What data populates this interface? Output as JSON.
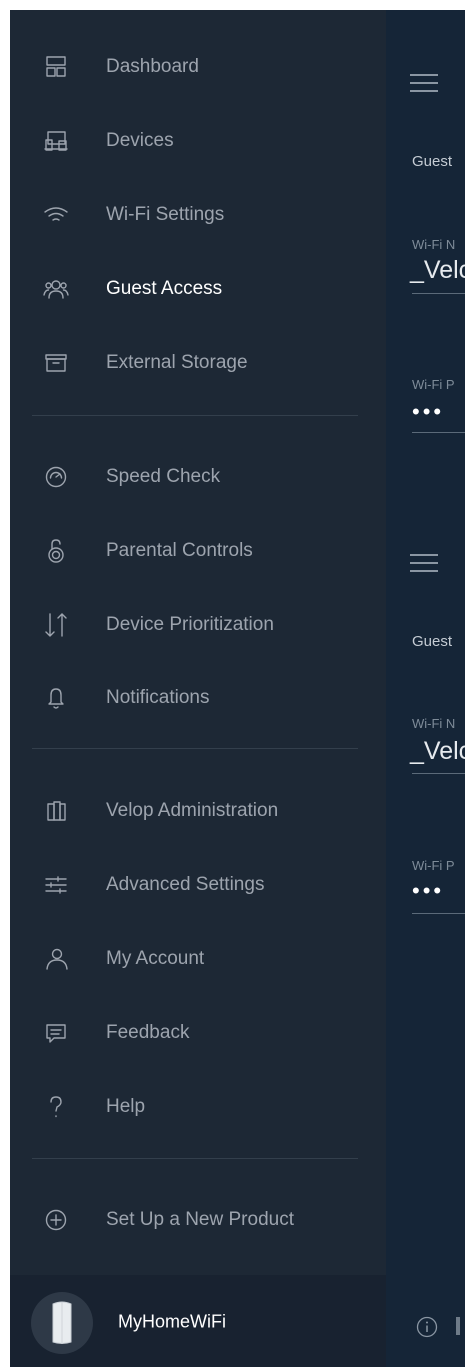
{
  "drawer": {
    "groups": [
      [
        {
          "id": "dashboard",
          "label": "Dashboard",
          "icon": "dashboard-icon"
        },
        {
          "id": "devices",
          "label": "Devices",
          "icon": "devices-icon"
        },
        {
          "id": "wifi-settings",
          "label": "Wi-Fi Settings",
          "icon": "wifi-icon"
        },
        {
          "id": "guest-access",
          "label": "Guest Access",
          "icon": "guest-users-icon",
          "active": true
        },
        {
          "id": "external-storage",
          "label": "External Storage",
          "icon": "storage-drive-icon"
        }
      ],
      [
        {
          "id": "speed-check",
          "label": "Speed Check",
          "icon": "speedometer-icon"
        },
        {
          "id": "parental-controls",
          "label": "Parental Controls",
          "icon": "padlock-icon"
        },
        {
          "id": "device-prioritization",
          "label": "Device Prioritization",
          "icon": "priority-arrows-icon"
        },
        {
          "id": "notifications",
          "label": "Notifications",
          "icon": "bell-icon"
        }
      ],
      [
        {
          "id": "velop-administration",
          "label": "Velop Administration",
          "icon": "velop-nodes-icon"
        },
        {
          "id": "advanced-settings",
          "label": "Advanced Settings",
          "icon": "sliders-icon"
        },
        {
          "id": "my-account",
          "label": "My Account",
          "icon": "user-icon"
        },
        {
          "id": "feedback",
          "label": "Feedback",
          "icon": "chat-bubble-icon"
        },
        {
          "id": "help",
          "label": "Help",
          "icon": "question-mark-icon"
        }
      ],
      [
        {
          "id": "set-up-new-product",
          "label": "Set Up a New Product",
          "icon": "plus-circle-icon"
        }
      ]
    ],
    "footer": {
      "network_name": "MyHomeWiFi",
      "icon": "velop-node-icon"
    }
  },
  "background_page": {
    "sections": [
      {
        "title": "Guest",
        "name_label": "Wi-Fi N",
        "name_value": "_Velc",
        "password_label": "Wi-Fi P",
        "password_mask": "•••"
      },
      {
        "title": "Guest",
        "name_label": "Wi-Fi N",
        "name_value": "_Velc",
        "password_label": "Wi-Fi P",
        "password_mask": "•••"
      }
    ]
  },
  "colors": {
    "drawer_bg": "#1d2835",
    "page_bg": "#152537",
    "text_muted": "#9da4ae",
    "text_active": "#ffffff"
  }
}
